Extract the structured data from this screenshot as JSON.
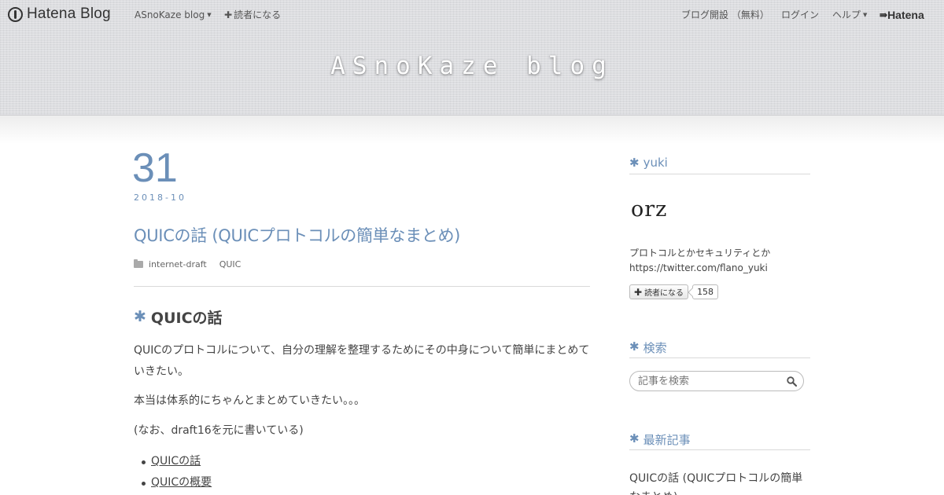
{
  "globalnav": {
    "logo_text": "Hatena Blog",
    "blog_menu_label": "ASnoKaze blog",
    "subscribe_label": "読者になる",
    "open_blog_label": "ブログ開設 （無料）",
    "login_label": "ログイン",
    "help_label": "ヘルプ",
    "hatena_label": "Hatena"
  },
  "blog": {
    "title": "ASnoKaze blog"
  },
  "entry": {
    "date_day": "31",
    "date_year_month": "2018-10",
    "title": "QUICの話 (QUICプロトコルの簡単なまとめ)",
    "categories": [
      "internet-draft",
      "QUIC"
    ],
    "heading": "QUICの話",
    "paragraphs": [
      "QUICのプロトコルについて、自分の理解を整理するためにその中身について簡単にまとめていきたい。",
      "本当は体系的にちゃんとまとめていきたい。。。",
      "(なお、draft16を元に書いている)"
    ],
    "toc": [
      "QUICの話",
      "QUICの概要"
    ]
  },
  "sidebar": {
    "profile_title": "yuki",
    "avatar_text": "orz",
    "profile_line1": "プロトコルとかセキュリティとか",
    "profile_line2": "https://twitter.com/flano_yuki",
    "subscribe_button_label": "読者になる",
    "subscriber_count": "158",
    "search_title": "検索",
    "search_placeholder": "記事を検索",
    "recent_title": "最新記事",
    "recent_first": "QUICの話 (QUICプロトコルの簡単なまとめ)"
  },
  "colors": {
    "accent": "#6b8fb8",
    "text": "#444444",
    "header_band": "#dcdde0"
  },
  "icons": {
    "logo": "hatena-pen-icon",
    "category": "folder-icon",
    "search": "magnifier-icon",
    "heading_marker": "asterisk-icon"
  }
}
